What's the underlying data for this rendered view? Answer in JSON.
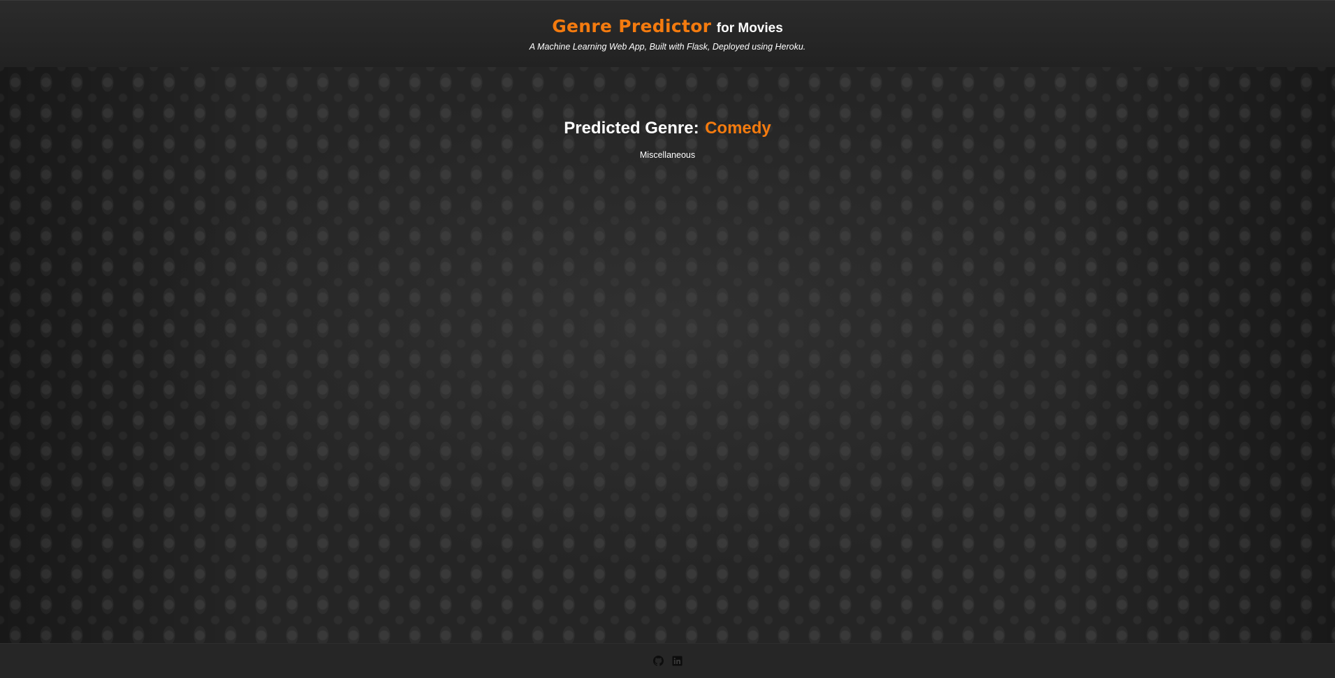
{
  "header": {
    "brand": "Genre Predictor",
    "brand_suffix": "for Movies",
    "subtitle": "A Machine Learning Web App, Built with Flask, Deployed using Heroku."
  },
  "result": {
    "label": "Predicted Genre:",
    "genre": "Comedy",
    "category": "Miscellaneous"
  },
  "footer": {
    "icons": [
      "github-icon",
      "linkedin-icon"
    ]
  },
  "colors": {
    "accent": "#f47b0f",
    "header_bg": "#262626",
    "text": "#ffffff"
  }
}
